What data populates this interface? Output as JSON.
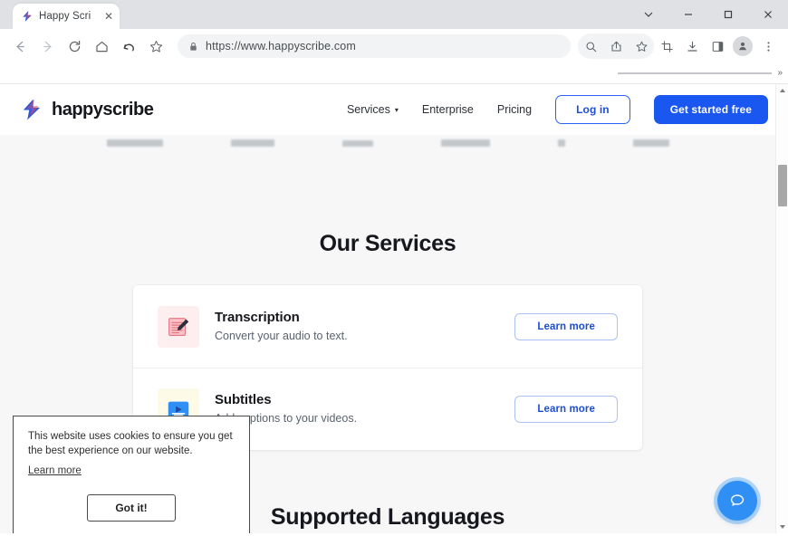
{
  "browser": {
    "tab": {
      "title": "Happy Scri",
      "favicon": "happyscribe-favicon",
      "close_label": "✕"
    },
    "window_controls": {
      "tab_search": "⌄",
      "minimize": "–",
      "maximize": "□",
      "close": "✕"
    },
    "toolbar": {
      "back": "back-arrow",
      "forward": "forward-arrow",
      "reload": "reload",
      "home": "home",
      "undo": "undo-arrow",
      "bookmark_star": "star",
      "url": "https://www.happyscribe.com",
      "lock": "lock",
      "zoom_search": "search",
      "share": "share",
      "star_right": "star",
      "collections": "crop",
      "downloads": "download",
      "split_screen": "split-screen",
      "profile": "profile",
      "menu": "three-dot-menu"
    },
    "bookmarks_bar": {
      "overflow": "»"
    }
  },
  "site": {
    "brand": {
      "name": "happyscribe"
    },
    "nav": [
      {
        "label": "Services",
        "has_caret": true,
        "caret": "▾"
      },
      {
        "label": "Enterprise",
        "has_caret": false
      },
      {
        "label": "Pricing",
        "has_caret": false
      }
    ],
    "buttons": {
      "login": "Log in",
      "cta": "Get started free"
    },
    "sections": {
      "services_title": "Our Services",
      "languages_title": "Supported Languages"
    },
    "services": [
      {
        "title": "Transcription",
        "desc": "Convert your audio to text.",
        "cta": "Learn more",
        "icon": "notepad-pen-icon"
      },
      {
        "title": "Subtitles",
        "desc": "Add captions to your videos.",
        "cta": "Learn more",
        "icon": "video-play-icon"
      }
    ],
    "cookie_banner": {
      "text": "This website uses cookies to ensure you get the best experience on our website.",
      "link": "Learn more",
      "accept": "Got it!"
    },
    "chat_widget": {
      "icon": "speech-bubble-icon"
    }
  },
  "colors": {
    "cta_blue": "#1a56f0",
    "link_blue": "#1d4ed8",
    "page_bg": "#f7f7f8",
    "chat_blue": "#2f8ff5"
  }
}
